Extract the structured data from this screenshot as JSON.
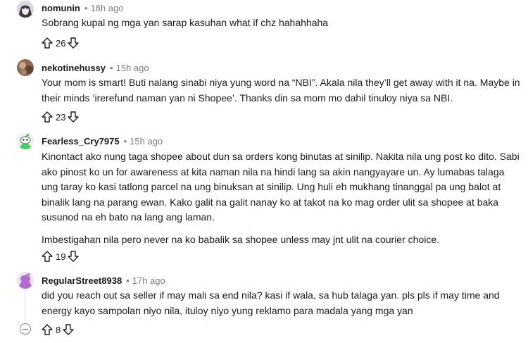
{
  "comments": [
    {
      "username": "nomunin",
      "time": "18h ago",
      "paragraphs": [
        "Sobrang kupal ng mga yan sarap kasuhan what if chz hahahhaha"
      ],
      "votes": "26",
      "avatar_icon": "anime-avatar-icon",
      "accent": "#5b5b6b"
    },
    {
      "username": "nekotinehussy",
      "time": "15h ago",
      "paragraphs": [
        "Your mom is smart! Buti nalang sinabi niya yung word na “NBI”. Akala nila they’ll get away with it na. Maybe in their minds ‘irerefund naman yan ni Shopee’. Thanks din sa mom mo dahil tinuloy niya sa NBI."
      ],
      "votes": "23",
      "avatar_icon": "photo-avatar-icon",
      "accent": "#8a6a52"
    },
    {
      "username": "Fearless_Cry7975",
      "time": "15h ago",
      "paragraphs": [
        "Kinontact ako nung taga shopee about dun sa orders kong binutas at sinilip. Nakita nila ung post ko dito. Sabi ako pinost ko un for awareness at kita naman nila na hindi lang sa akin nangyayare un. Ay lumabas talaga ung taray ko kasi tatlong parcel na ung binuksan at sinilip. Ung huli eh mukhang tinanggal pa ung balot at binalik lang na parang ewan. Kako galit na galit nanay ko at takot na ko mag order ulit sa shopee at baka susunod na eh bato na lang ang laman.",
        "Imbestigahan nila pero never na ko babalik sa shopee unless may jnt ulit na courier choice."
      ],
      "votes": "19",
      "avatar_icon": "snoo-avatar-icon",
      "accent": "#46d160"
    },
    {
      "username": "RegularStreet8938",
      "time": "17h ago",
      "paragraphs": [
        "did you reach out sa seller if may mali sa end nila? kasi if wala, sa hub talaga yan. pls pls if may time and energy kayo sampolan niyo nila, ituloy niyo yung reklamo para madala yang mga yan"
      ],
      "votes": "8",
      "avatar_icon": "snoo-avatar-icon",
      "accent": "#b26bcf"
    }
  ]
}
